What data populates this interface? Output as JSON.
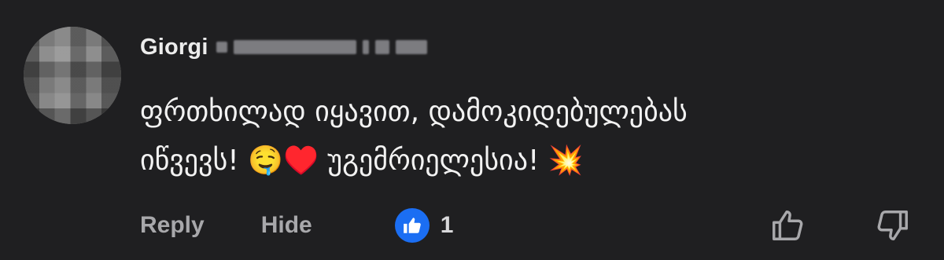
{
  "comment": {
    "author_name": "Giorgi",
    "text_line1": "ფრთხილად იყავით, დამოკიდებულებას",
    "text_line2_a": "იწვევს!",
    "emoji_1": "🤤",
    "emoji_2": "♥️",
    "text_line2_b": "უგემრიელესია!",
    "emoji_3": "💥"
  },
  "actions": {
    "reply_label": "Reply",
    "hide_label": "Hide",
    "like_count": "1"
  },
  "colors": {
    "background": "#1f1f21",
    "like_badge": "#1b6ef3",
    "action_text": "#a8a8ab"
  },
  "icons": {
    "like_badge": "thumbs-up-icon",
    "vote_up": "thumbs-up-outline-icon",
    "vote_down": "thumbs-down-outline-icon"
  }
}
